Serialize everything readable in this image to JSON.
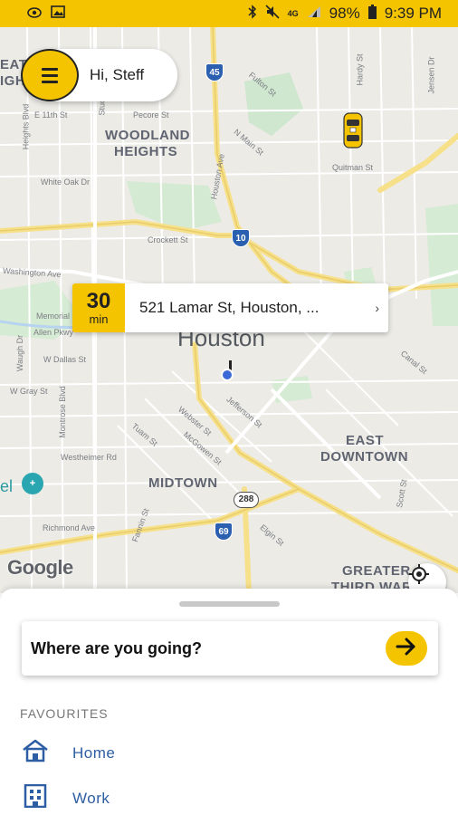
{
  "status_bar": {
    "battery": "98%",
    "time": "9:39 PM",
    "network": "4G",
    "icons": [
      "eye-icon",
      "image-icon",
      "bluetooth-icon",
      "mute-icon",
      "signal-icon",
      "battery-icon"
    ]
  },
  "header": {
    "greeting": "Hi, Steff",
    "menu_icon": "hamburger-menu-icon"
  },
  "map": {
    "labels": {
      "woodland": "WOODLAND",
      "heights": "HEIGHTS",
      "heights_partial": "EAT",
      "heights_partial2": "IGH",
      "houston": "Houston",
      "east": "EAST",
      "downtown": "DOWNTOWN",
      "midtown": "MIDTOWN",
      "greater": "GREATER",
      "third_ward": "THIRD WARD",
      "partial_el": "el",
      "e_11th": "E 11th St",
      "pecore": "Pecore St",
      "white_oak": "White Oak Dr",
      "crockett": "Crockett St",
      "washington": "Washington Ave",
      "w_dallas": "W Dallas St",
      "w_gray": "W Gray St",
      "westheimer": "Westheimer Rd",
      "richmond": "Richmond Ave",
      "jefferson": "Jefferson St",
      "webster": "Webster St",
      "mcgowen": "McGowen St",
      "tuam": "Tuam St",
      "elgin": "Elgin St",
      "canal": "Canal St",
      "quitman": "Quitman St",
      "fulton": "Fulton St",
      "n_main": "N Main St",
      "houston_ave": "Houston Ave",
      "scott": "Scott St",
      "jensen": "Jensen Dr",
      "hardy": "Hardy St",
      "montrose": "Montrose Blvd",
      "waugh": "Waugh Dr",
      "allen": "Allen Pkwy",
      "memorial": "Memorial",
      "heights_blvd": "Heights Blvd",
      "studewood": "Studewood",
      "fannin": "Fannin St",
      "i45": "45",
      "i10": "10",
      "i69": "69",
      "hwy288": "288"
    },
    "google_logo": "Google",
    "taxi_icon": "taxi-car-icon",
    "locate_icon": "locate-crosshair-icon"
  },
  "eta": {
    "minutes": "30",
    "unit": "min",
    "address": "521 Lamar St, Houston, ...",
    "chevron": "›"
  },
  "sheet": {
    "search_placeholder": "Where are you going?",
    "go_icon": "arrow-right-icon",
    "favourites_title": "FAVOURITES",
    "favourites": [
      {
        "label": "Home",
        "icon": "home-icon"
      },
      {
        "label": "Work",
        "icon": "building-icon"
      }
    ]
  },
  "colors": {
    "accent": "#f5c400",
    "link": "#2d5ea3",
    "map_bg": "#ecebe6"
  }
}
